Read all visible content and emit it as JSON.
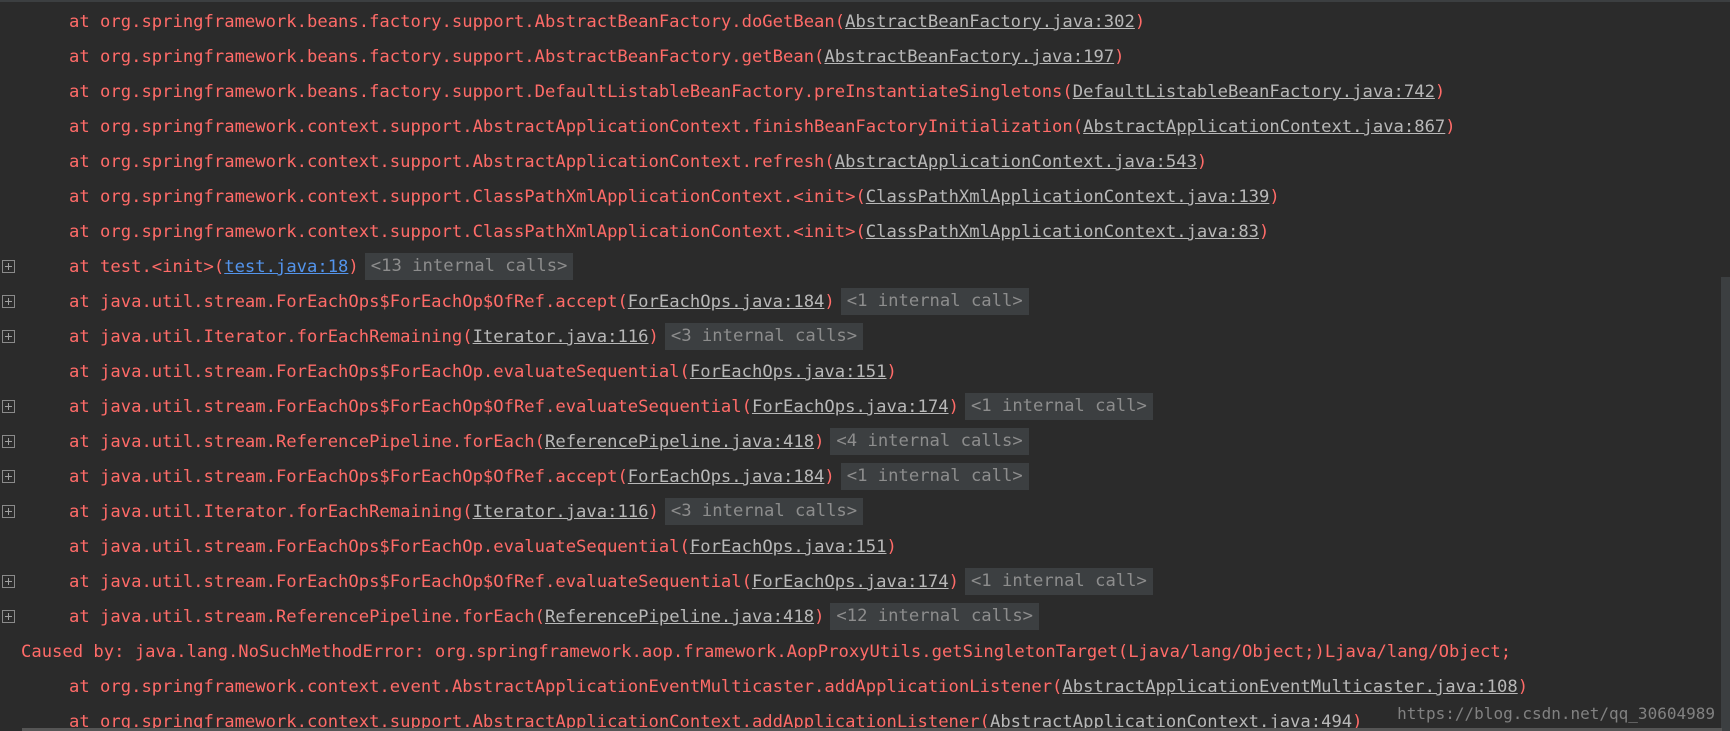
{
  "colors": {
    "background": "#2b2b2b",
    "error_text": "#ff6b68",
    "link_text": "#b8b8b8",
    "link_blue": "#5394ec",
    "internal_calls_bg": "#3c3f41",
    "internal_calls_text": "#8d8d8d"
  },
  "icons": {
    "expand": "expand-plus-icon"
  },
  "lines": [
    {
      "prefix": "at ",
      "method": "org.springframework.beans.factory.support.AbstractBeanFactory.doGetBean",
      "link": "AbstractBeanFactory.java:302",
      "internal": ""
    },
    {
      "prefix": "at ",
      "method": "org.springframework.beans.factory.support.AbstractBeanFactory.getBean",
      "link": "AbstractBeanFactory.java:197",
      "internal": ""
    },
    {
      "prefix": "at ",
      "method": "org.springframework.beans.factory.support.DefaultListableBeanFactory.preInstantiateSingletons",
      "link": "DefaultListableBeanFactory.java:742",
      "internal": ""
    },
    {
      "prefix": "at ",
      "method": "org.springframework.context.support.AbstractApplicationContext.finishBeanFactoryInitialization",
      "link": "AbstractApplicationContext.java:867",
      "internal": ""
    },
    {
      "prefix": "at ",
      "method": "org.springframework.context.support.AbstractApplicationContext.refresh",
      "link": "AbstractApplicationContext.java:543",
      "internal": ""
    },
    {
      "prefix": "at ",
      "method": "org.springframework.context.support.ClassPathXmlApplicationContext.<init>",
      "link": "ClassPathXmlApplicationContext.java:139",
      "internal": ""
    },
    {
      "prefix": "at ",
      "method": "org.springframework.context.support.ClassPathXmlApplicationContext.<init>",
      "link": "ClassPathXmlApplicationContext.java:83",
      "internal": ""
    },
    {
      "prefix": "at ",
      "method": "test.<init>",
      "link": "test.java:18",
      "internal": "<13 internal calls>"
    },
    {
      "prefix": "at ",
      "method": "java.util.stream.ForEachOps$ForEachOp$OfRef.accept",
      "link": "ForEachOps.java:184",
      "internal": "<1 internal call>"
    },
    {
      "prefix": "at ",
      "method": "java.util.Iterator.forEachRemaining",
      "link": "Iterator.java:116",
      "internal": "<3 internal calls>"
    },
    {
      "prefix": "at ",
      "method": "java.util.stream.ForEachOps$ForEachOp.evaluateSequential",
      "link": "ForEachOps.java:151",
      "internal": ""
    },
    {
      "prefix": "at ",
      "method": "java.util.stream.ForEachOps$ForEachOp$OfRef.evaluateSequential",
      "link": "ForEachOps.java:174",
      "internal": "<1 internal call>"
    },
    {
      "prefix": "at ",
      "method": "java.util.stream.ReferencePipeline.forEach",
      "link": "ReferencePipeline.java:418",
      "internal": "<4 internal calls>"
    },
    {
      "prefix": "at ",
      "method": "java.util.stream.ForEachOps$ForEachOp$OfRef.accept",
      "link": "ForEachOps.java:184",
      "internal": "<1 internal call>"
    },
    {
      "prefix": "at ",
      "method": "java.util.Iterator.forEachRemaining",
      "link": "Iterator.java:116",
      "internal": "<3 internal calls>"
    },
    {
      "prefix": "at ",
      "method": "java.util.stream.ForEachOps$ForEachOp.evaluateSequential",
      "link": "ForEachOps.java:151",
      "internal": ""
    },
    {
      "prefix": "at ",
      "method": "java.util.stream.ForEachOps$ForEachOp$OfRef.evaluateSequential",
      "link": "ForEachOps.java:174",
      "internal": "<1 internal call>"
    },
    {
      "prefix": "at ",
      "method": "java.util.stream.ReferencePipeline.forEach",
      "link": "ReferencePipeline.java:418",
      "internal": "<12 internal calls>"
    },
    {
      "caused": "Caused by: java.lang.NoSuchMethodError: org.springframework.aop.framework.AopProxyUtils.getSingletonTarget(Ljava/lang/Object;)Ljava/lang/Object;"
    },
    {
      "prefix": "at ",
      "method": "org.springframework.context.event.AbstractApplicationEventMulticaster.addApplicationListener",
      "link": "AbstractApplicationEventMulticaster.java:108",
      "internal": ""
    },
    {
      "prefix": "at ",
      "method": "org.springframework.context.support.AbstractApplicationContext.addApplicationListener",
      "link": "AbstractApplicationContext.java:494",
      "internal": ""
    }
  ],
  "watermark": "https://blog.csdn.net/qq_30604989"
}
